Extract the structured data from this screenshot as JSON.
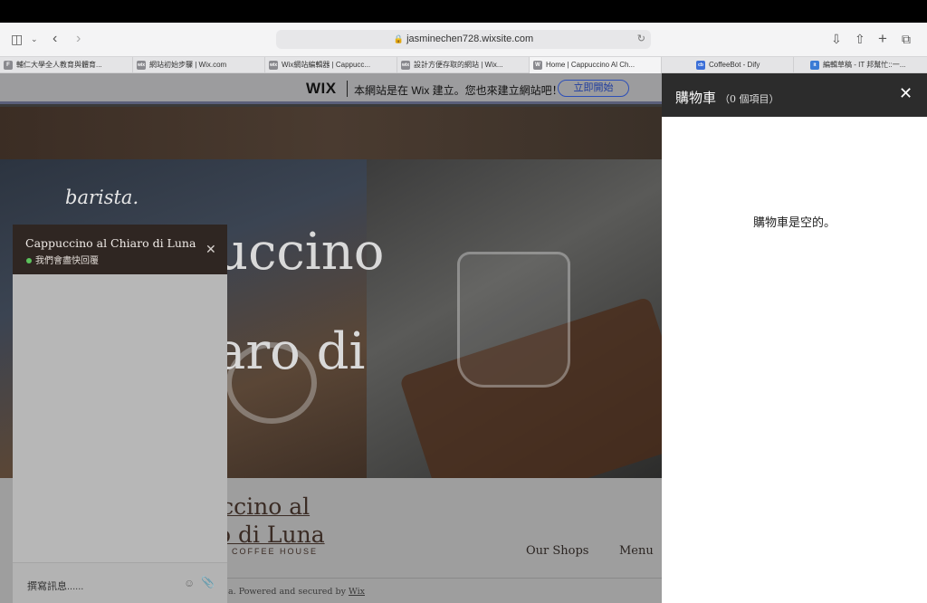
{
  "browser": {
    "url": "jasminechen728.wixsite.com",
    "tabs": [
      {
        "label": "輔仁大學全人教育與體育...",
        "favicon": "F"
      },
      {
        "label": "網站初始步驟 | Wix.com",
        "favicon": "wix"
      },
      {
        "label": "Wix網站編輯器 | Cappucc...",
        "favicon": "wix"
      },
      {
        "label": "設計方便存取的網站 | Wix...",
        "favicon": "wix"
      },
      {
        "label": "Home | Cappuccino Al Ch...",
        "favicon": "W"
      },
      {
        "label": "CoffeeBot - Dify",
        "favicon": "cb"
      },
      {
        "label": "編輯草稿 - IT 邦幫忙::一...",
        "favicon": "it"
      }
    ]
  },
  "wix_banner": {
    "logo": "WIX",
    "text": "本網站是在 Wix 建立。您也來建立網站吧！",
    "button": "立即開始"
  },
  "hero": {
    "script_logo": "barista.",
    "heading_line1": "uccino",
    "heading_line2": "aro di"
  },
  "site": {
    "brand_line1": "uccino al",
    "brand_line2": "ro di Luna",
    "tagline": "COFFEE HOUSE",
    "nav": [
      "Our Shops",
      "Menu"
    ],
    "footer_prefix": "a. Powered and secured by ",
    "footer_link": "Wix"
  },
  "chat": {
    "title": "Cappuccino al Chiaro di Luna",
    "status": "我們會盡快回覆",
    "input_placeholder": "撰寫訊息......"
  },
  "cart": {
    "title": "購物車",
    "count_text": "（0 個項目）",
    "empty_message": "購物車是空的。"
  }
}
